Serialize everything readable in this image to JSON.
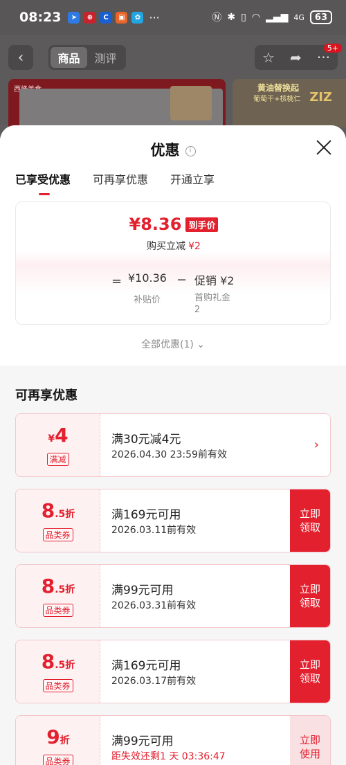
{
  "status_bar": {
    "time": "08:23",
    "more": "···",
    "signal_label": "4G",
    "battery": "63"
  },
  "header": {
    "back_icon": "‹",
    "tabs": [
      "商品",
      "测评"
    ],
    "badge": "5+"
  },
  "banner": {
    "brand_small": "西峰美食",
    "promo_title": "黄油替换起",
    "promo_sub": "葡萄干+核桃仁",
    "promo_brand": "ZIZ"
  },
  "sheet": {
    "title": "优惠",
    "tabs": [
      "已享受优惠",
      "可再享优惠",
      "开通立享"
    ],
    "price_card": {
      "final_price": "¥8.36",
      "final_tag": "到手价",
      "reduce_label": "购买立减",
      "reduce_value": "¥2",
      "eq": "=",
      "subsidy_price": "¥10.36",
      "subsidy_label": "补贴价",
      "minus": "−",
      "promo_label": "促销 ¥2",
      "promo_sub1": "首购礼金",
      "promo_sub2": "2"
    },
    "all_discount": "全部优惠(1)",
    "section_title": "可再享优惠",
    "coupons": [
      {
        "value": "4",
        "prefix": "¥",
        "unit": "",
        "type": "满减",
        "main": "满30元减4元",
        "sub": "2026.04.30 23:59前有效",
        "action": "›"
      },
      {
        "value": "8",
        "prefix": "",
        "unit": ".5折",
        "type": "品类券",
        "main": "满169元可用",
        "sub": "2026.03.11前有效",
        "action": "立即\n领取"
      },
      {
        "value": "8",
        "prefix": "",
        "unit": ".5折",
        "type": "品类券",
        "main": "满99元可用",
        "sub": "2026.03.31前有效",
        "action": "立即\n领取"
      },
      {
        "value": "8",
        "prefix": "",
        "unit": ".5折",
        "type": "品类券",
        "main": "满169元可用",
        "sub": "2026.03.17前有效",
        "action": "立即\n领取"
      },
      {
        "value": "9",
        "prefix": "",
        "unit": "折",
        "type": "品类券",
        "main": "满99元可用",
        "sub": "距失效还剩1 天 03:36:47",
        "action": "立即\n使用"
      }
    ]
  }
}
